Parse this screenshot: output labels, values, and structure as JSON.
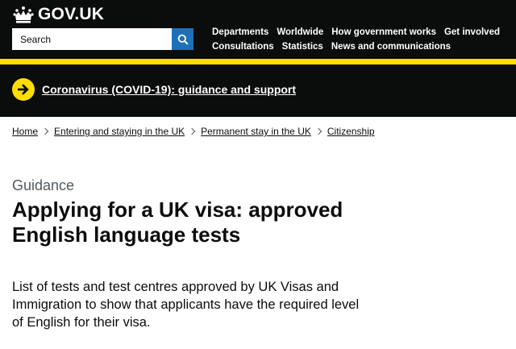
{
  "header": {
    "logo_text": "GOV.UK",
    "search": {
      "placeholder": "Search",
      "button_label": "Search"
    },
    "nav_rows": [
      [
        "Departments",
        "Worldwide",
        "How government works",
        "Get involved"
      ],
      [
        "Consultations",
        "Statistics",
        "News and communications"
      ]
    ],
    "colors": {
      "background": "#0b0c0c",
      "accent_bar": "#ffdd00",
      "search_button": "#1d70b8"
    }
  },
  "banner": {
    "link_text": "Coronavirus (COVID-19): guidance and support",
    "icon": "arrow-right-circle-icon",
    "colors": {
      "background": "#0b0c0c",
      "icon": "#ffdd00"
    }
  },
  "breadcrumbs": [
    "Home",
    "Entering and staying in the UK",
    "Permanent stay in the UK",
    "Citizenship"
  ],
  "main": {
    "caption": "Guidance",
    "title_line1": "Applying for a UK visa: approved",
    "title_line2": "English language tests",
    "description_line1": "List of tests and test centres approved by UK Visas and",
    "description_line2": "Immigration to show that applicants have the required level",
    "description_line3": "of English for their visa."
  }
}
